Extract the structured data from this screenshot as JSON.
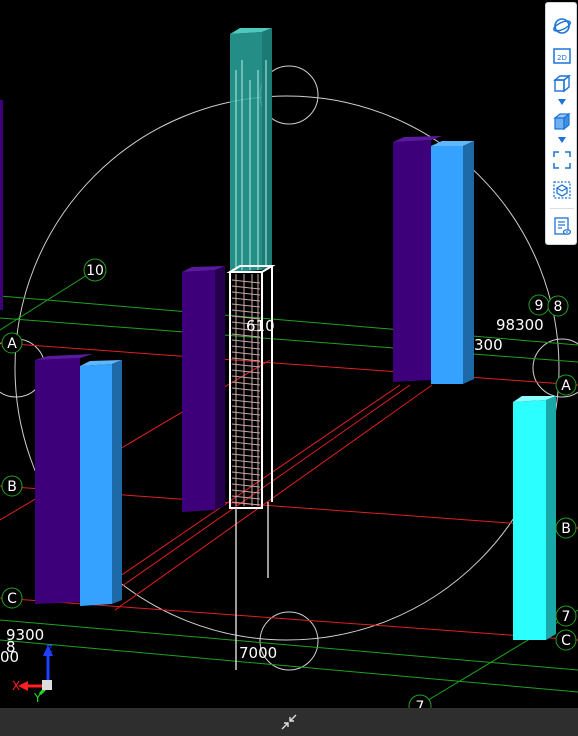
{
  "grid_labels": {
    "axis_A": "A",
    "axis_B": "B",
    "axis_C": "C",
    "axis_10": "10",
    "axis_9": "9",
    "axis_8": "8",
    "axis_7": "7",
    "axis_7_lower": "7",
    "axis_A_right": "A",
    "axis_B_right": "B",
    "axis_C_right": "C"
  },
  "dimensions": {
    "dim_98300": "98300",
    "dim_300_right": "300",
    "dim_9300_left": "9300",
    "dim_00_left": "00",
    "dim_8_left": "8",
    "dim_7000": "7000",
    "dim_610": "610"
  },
  "axes_triad": {
    "x": "X",
    "y": "Y",
    "z": "Z"
  },
  "toolbar": {
    "items": [
      {
        "name": "orbit",
        "icon": "orbit-icon"
      },
      {
        "name": "2d-view",
        "icon": "2d-view-icon",
        "label": "2D"
      },
      {
        "name": "3d-view",
        "icon": "cube-outline-icon"
      },
      {
        "name": "shaded-view",
        "icon": "cube-shaded-icon"
      },
      {
        "name": "fit-view",
        "icon": "fit-frame-icon"
      },
      {
        "name": "section-box",
        "icon": "section-box-icon"
      },
      {
        "name": "properties-view",
        "icon": "properties-view-icon"
      }
    ]
  },
  "colors": {
    "background": "#000000",
    "grid_red": "#e02020",
    "grid_green": "#1fa21f",
    "column_purple": "#3d007a",
    "column_blue": "#35a2ff",
    "column_cyan": "#2bffff",
    "column_teal": "#2aa69e",
    "accent": "#1a73d9"
  }
}
